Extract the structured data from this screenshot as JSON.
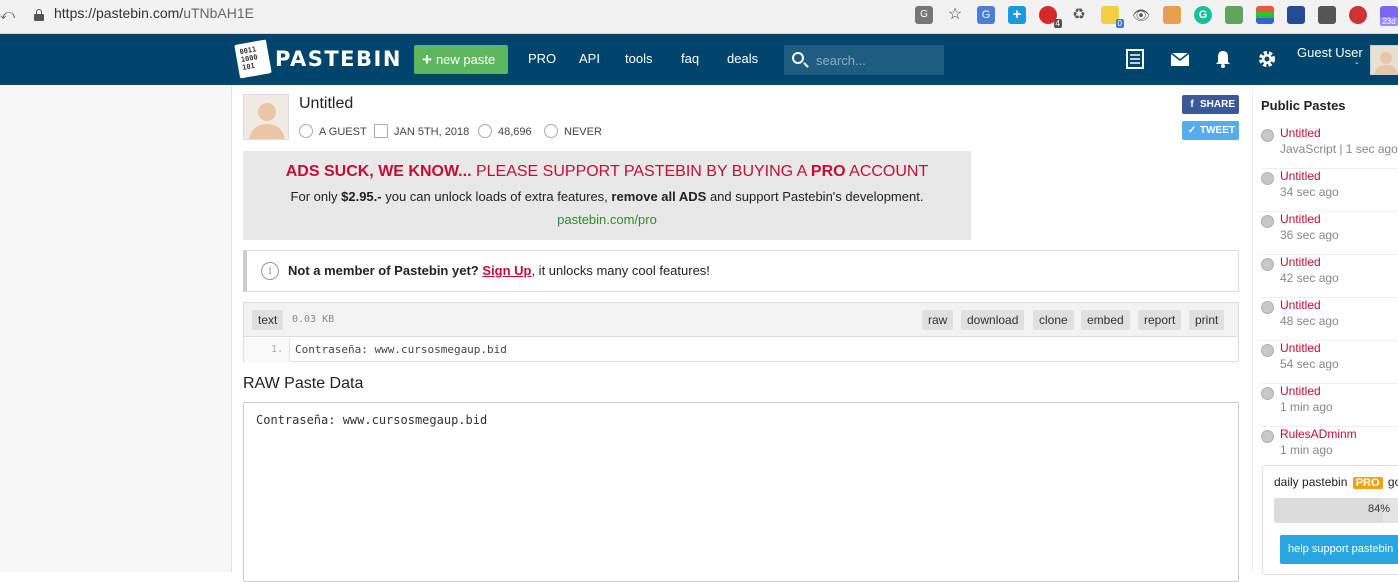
{
  "browser": {
    "url_host": "https://pastebin.com/",
    "url_path": "uTNbAH1E",
    "badge_4": "4",
    "badge_0": "0",
    "badge_23d": "23d"
  },
  "header": {
    "brand": "PASTEBIN",
    "logo_text": "0011\n1000\n101",
    "new_paste": "new paste",
    "nav": [
      "PRO",
      "API",
      "tools",
      "faq",
      "deals"
    ],
    "search_placeholder": "search...",
    "user": "Guest User",
    "user_arrow": "-"
  },
  "paste": {
    "title": "Untitled",
    "author": "A GUEST",
    "date": "JAN 5TH, 2018",
    "views": "48,696",
    "expire": "NEVER",
    "share": "SHARE",
    "tweet": "TWEET"
  },
  "ad": {
    "bold": "ADS SUCK, WE KNOW...",
    "line1_mid": " PLEASE SUPPORT PASTEBIN BY BUYING A ",
    "pro": "PRO",
    "line1_end": " ACCOUNT",
    "line2_a": "For only ",
    "price": "$2.95.-",
    "line2_b": " you can unlock loads of extra features, ",
    "remove": "remove all ADS",
    "line2_c": " and support Pastebin's development.",
    "link": "pastebin.com/pro"
  },
  "notice": {
    "bold": "Not a member of Pastebin yet?",
    "signup": "Sign Up",
    "rest": ", it unlocks many cool features!"
  },
  "code": {
    "syntax": "text",
    "size": "0.03 KB",
    "actions": [
      "raw",
      "download",
      "clone",
      "embed",
      "report",
      "print"
    ],
    "line_number": "1.",
    "line_text": "Contraseña: www.cursosmegaup.bid"
  },
  "raw": {
    "title": "RAW Paste Data",
    "content": "Contraseña: www.cursosmegaup.bid"
  },
  "public_pastes": {
    "title": "Public Pastes",
    "items": [
      {
        "name": "Untitled",
        "sub": "JavaScript | 1 sec ago"
      },
      {
        "name": "Untitled",
        "sub": "34 sec ago"
      },
      {
        "name": "Untitled",
        "sub": "36 sec ago"
      },
      {
        "name": "Untitled",
        "sub": "42 sec ago"
      },
      {
        "name": "Untitled",
        "sub": "48 sec ago"
      },
      {
        "name": "Untitled",
        "sub": "54 sec ago"
      },
      {
        "name": "Untitled",
        "sub": "1 min ago"
      },
      {
        "name": "RulesADminm",
        "sub": "1 min ago"
      }
    ]
  },
  "goal": {
    "prefix": "daily pastebin ",
    "pro": "PRO",
    "suffix": " goal",
    "percent_label": "84%",
    "percent": 84,
    "help": "help support pastebin"
  },
  "colors": {
    "header_bg": "#02456c",
    "accent_red": "#c20e36",
    "new_paste_green": "#5cb85c"
  }
}
